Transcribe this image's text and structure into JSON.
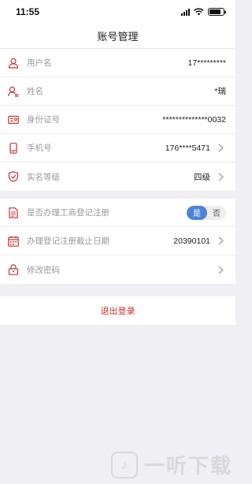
{
  "status_bar": {
    "time": "11:55"
  },
  "nav": {
    "title": "账号管理"
  },
  "account_rows": [
    {
      "label": "用户名",
      "value": "17*********"
    },
    {
      "label": "姓名",
      "value": "*瑞"
    },
    {
      "label": "身份证号",
      "value": "**************0032"
    },
    {
      "label": "手机号",
      "value": "176****5471"
    },
    {
      "label": "实名等级",
      "value": "四级"
    }
  ],
  "business": {
    "registration_label": "是否办理工商登记注册",
    "toggle_yes": "是",
    "toggle_no": "否",
    "toggle_selected": "是",
    "deadline_label": "办理登记注册截止日期",
    "deadline_value": "20390101",
    "change_password_label": "修改密码"
  },
  "logout": {
    "label": "退出登录"
  },
  "watermark": {
    "text": "一听下载"
  },
  "colors": {
    "accent_red": "#c9302c",
    "toggle_blue": "#4a84d6",
    "background": "#efeff4"
  }
}
